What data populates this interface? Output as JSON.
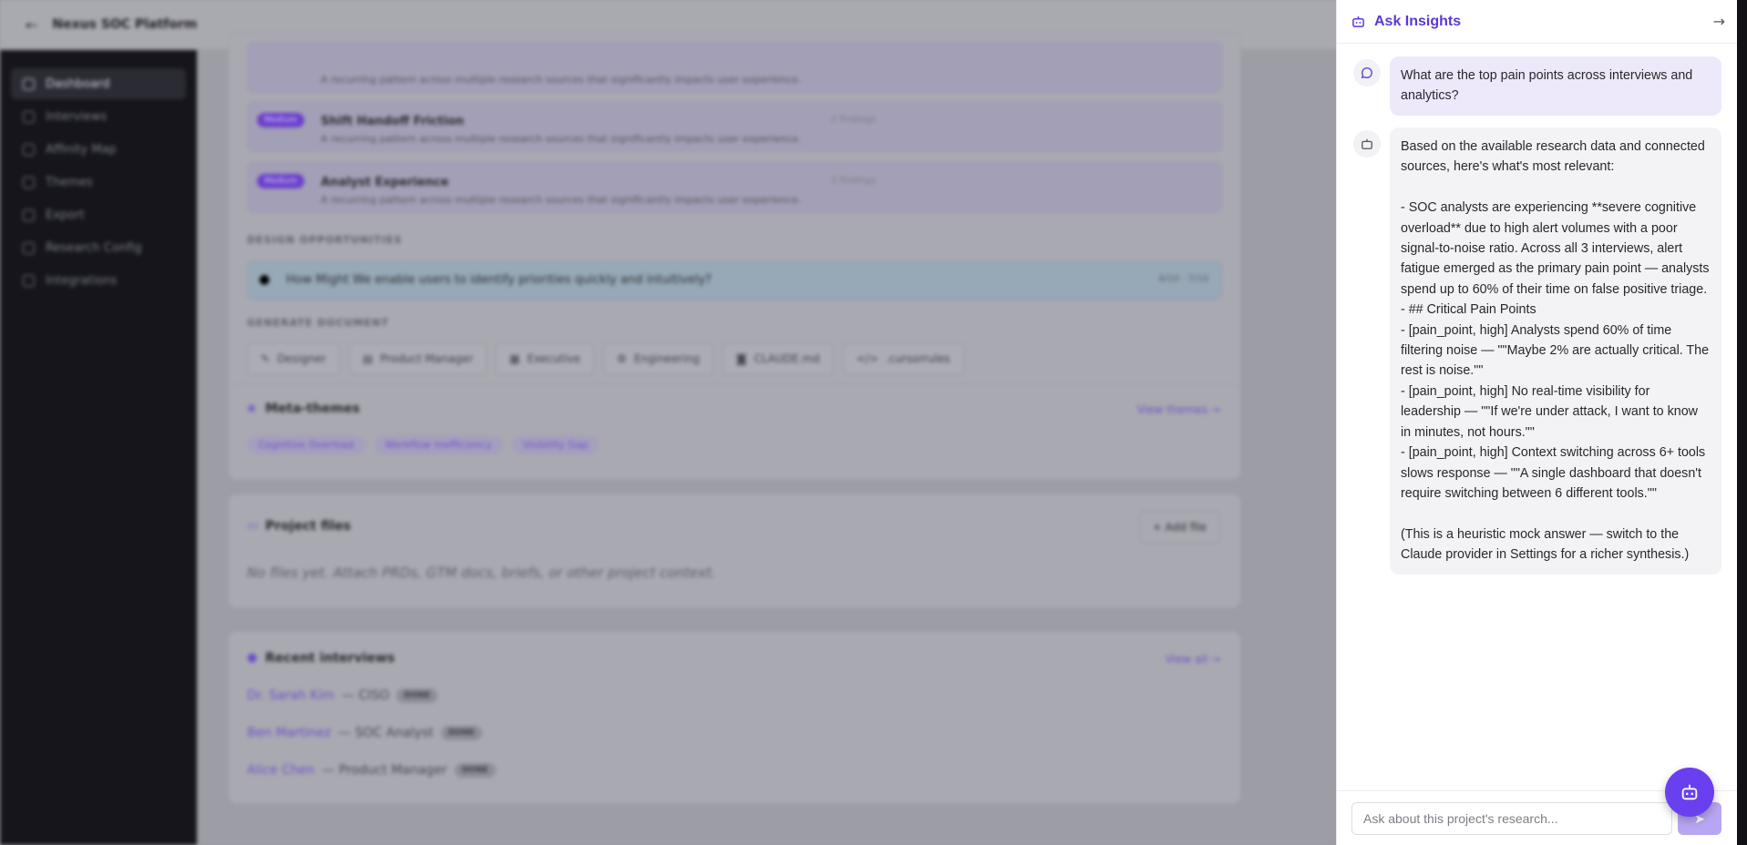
{
  "header": {
    "back_icon": "arrow-left-icon",
    "title": "Nexus SOC Platform"
  },
  "sidebar": {
    "items": [
      {
        "label": "Dashboard",
        "icon": "grid-icon"
      },
      {
        "label": "Interviews",
        "icon": "mic-icon"
      },
      {
        "label": "Affinity Map",
        "icon": "map-icon"
      },
      {
        "label": "Themes",
        "icon": "layers-icon"
      },
      {
        "label": "Export",
        "icon": "export-icon"
      },
      {
        "label": "Research Config",
        "icon": "gear-icon"
      },
      {
        "label": "Integrations",
        "icon": "plug-icon"
      }
    ]
  },
  "themes": [
    {
      "badge": "",
      "title": "",
      "subtitle": "A recurring pattern across multiple research sources that significantly impacts user experience.",
      "count": ""
    },
    {
      "badge": "Medium",
      "title": "Shift Handoff Friction",
      "subtitle": "A recurring pattern across multiple research sources that significantly impacts user experience.",
      "count": "2 findings"
    },
    {
      "badge": "Medium",
      "title": "Analyst Experience",
      "subtitle": "A recurring pattern across multiple research sources that significantly impacts user experience.",
      "count": "2 findings"
    }
  ],
  "design_opportunities": {
    "label": "DESIGN OPPORTUNITIES",
    "hmw": "How Might We enable users to identify priorities quickly and intuitively?",
    "meta": "6/10 · 7/10"
  },
  "generate_document": {
    "label": "GENERATE DOCUMENT",
    "buttons": [
      "Designer",
      "Product Manager",
      "Executive",
      "Engineering",
      "CLAUDE.md",
      ".cursorrules"
    ]
  },
  "meta_themes": {
    "title": "Meta-themes",
    "link": "View themes →",
    "tags": [
      "Cognitive Overload",
      "Workflow Inefficiency",
      "Visibility Gap"
    ]
  },
  "project_files": {
    "title": "Project files",
    "add_label": "+ Add file",
    "empty": "No files yet. Attach PRDs, GTM docs, briefs, or other project context."
  },
  "recent_interviews": {
    "title": "Recent interviews",
    "link": "View all →",
    "items": [
      {
        "name": "Dr. Sarah Kim",
        "role": "— CISO",
        "status": "DONE"
      },
      {
        "name": "Ben Martinez",
        "role": "— SOC Analyst",
        "status": "DONE"
      },
      {
        "name": "Alice Chen",
        "role": "— Product Manager",
        "status": "DONE"
      }
    ]
  },
  "insights": {
    "title": "Ask Insights",
    "user_message": "What are the top pain points across interviews and analytics?",
    "bot_message": "Based on the available research data and connected sources, here's what's most relevant:\n\n- SOC analysts are experiencing **severe cognitive overload** due to high alert volumes with a poor signal-to-noise ratio. Across all 3 interviews, alert fatigue emerged as the primary pain point — analysts spend up to 60% of their time on false positive triage.\n- ## Critical Pain Points\n- [pain_point, high] Analysts spend 60% of time filtering noise — \"\"Maybe 2% are actually critical. The rest is noise.\"\"\n- [pain_point, high] No real-time visibility for leadership — \"\"If we're under attack, I want to know in minutes, not hours.\"\"\n- [pain_point, high] Context switching across 6+ tools slows response — \"\"A single dashboard that doesn't require switching between 6 different tools.\"\"\n\n(This is a heuristic mock answer — switch to the Claude provider in Settings for a richer synthesis.)",
    "input_placeholder": "Ask about this project's research...",
    "accent": "#5b38d6"
  }
}
